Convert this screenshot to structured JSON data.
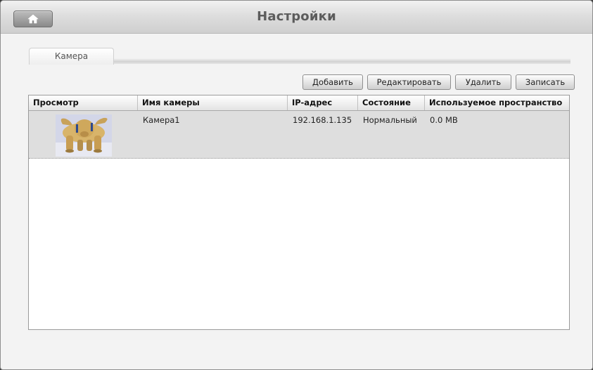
{
  "window": {
    "title": "Настройки"
  },
  "tabs": [
    {
      "label": "Камера",
      "active": true
    }
  ],
  "toolbar": {
    "add_label": "Добавить",
    "edit_label": "Редактировать",
    "delete_label": "Удалить",
    "record_label": "Записать"
  },
  "table": {
    "columns": [
      "Просмотр",
      "Имя камеры",
      "IP-адрес",
      "Состояние",
      "Используемое пространство"
    ],
    "rows": [
      {
        "name": "Камера1",
        "ip": "192.168.1.135",
        "status": "Нормальный",
        "space": "0.0 MB"
      }
    ]
  },
  "icons": {
    "home": "home-icon"
  },
  "colors": {
    "selected_row": "#dedede",
    "title_text": "#5c5c5c"
  }
}
